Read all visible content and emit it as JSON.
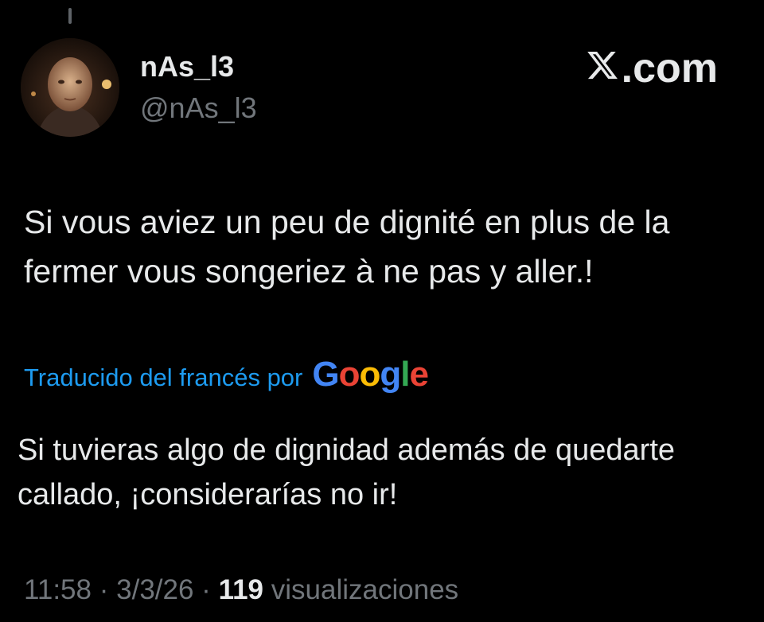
{
  "author": {
    "display_name": "nAs_l3",
    "handle": "@nAs_l3"
  },
  "brand": {
    "label": ".com",
    "icon": "x-logo-icon"
  },
  "tweet": {
    "text": "Si vous aviez un peu de dignité en plus de la fermer vous songeriez à ne pas y aller.!"
  },
  "translation": {
    "label": "Traducido del francés por",
    "provider_letters": [
      "G",
      "o",
      "o",
      "g",
      "l",
      "e"
    ],
    "text": "Si tuvieras algo de dignidad además de quedarte callado, ¡considerarías no ir!"
  },
  "meta": {
    "time": "11:58",
    "separator": "·",
    "date": "3/3/26",
    "views_count": "119",
    "views_label": "visualizaciones"
  },
  "colors": {
    "background": "#000000",
    "primary_text": "#e7e9ea",
    "secondary_text": "#71767b",
    "link": "#1d9bf0",
    "google_blue": "#4285f4",
    "google_red": "#ea4335",
    "google_yellow": "#fbbc05",
    "google_green": "#34a853"
  }
}
